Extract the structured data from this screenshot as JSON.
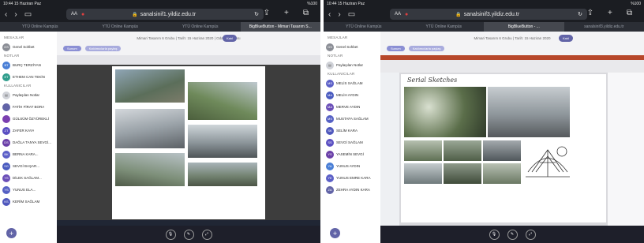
{
  "screens": [
    {
      "status": {
        "time": "10:44  15 Haziran Paz",
        "battery": "%100"
      },
      "url": "sanalsinif1.yildiz.edu.tr",
      "url_aa": "AA",
      "tabs": [
        {
          "label": "YTÜ Online Kampüs",
          "active": false
        },
        {
          "label": "YTÜ Online Kampüs",
          "active": false
        },
        {
          "label": "YTÜ Online Kampüs",
          "active": false
        },
        {
          "label": "BigBlueButton - Mimari Tasarım S...",
          "active": true
        }
      ],
      "sidebar": {
        "sections": [
          {
            "title": "MESAJLAR",
            "items": [
              {
                "initials": "GS",
                "label": "Genel Sohbet"
              }
            ]
          },
          {
            "title": "NOTLAR",
            "items": [
              {
                "initials": "BT",
                "label": "BURÇ TERZİYAN"
              },
              {
                "initials": "ET",
                "label": "ETHEM CAN TEKİN"
              }
            ]
          },
          {
            "title": "KULLANICILAR",
            "items": [
              {
                "initials": "",
                "label": "Paylaşılan Notlar"
              },
              {
                "initials": "",
                "label": "FATİH FİRAT BORA"
              },
              {
                "initials": "",
                "label": "GÜLSÜM ÖZYÜREKLİ"
              },
              {
                "initials": "ZT",
                "label": "ZAFER KAYA"
              },
              {
                "initials": "DS",
                "label": "DAĞLA TANYA SEVGİ..."
              },
              {
                "initials": "BK",
                "label": "BERNA KARA..."
              },
              {
                "initials": "SG",
                "label": "SEVGİ BAŞAR..."
              },
              {
                "initials": "YS",
                "label": "DİLEK SAĞLAM..."
              },
              {
                "initials": "YS",
                "label": "YUNUS ELA..."
              },
              {
                "initials": "KS",
                "label": "KERİM SAĞLAM"
              }
            ]
          }
        ]
      },
      "meeting": {
        "title": "Mimari Tasarım 6 Grubu | Tarih: 15 Haziran 2020 | Oda Kullanıcısı",
        "chip_primary": "Sunum",
        "chip_secondary": "Katılımcılarla paylaş",
        "join_label": "Katıl"
      },
      "callbar_icons": [
        "mic-icon",
        "video-icon",
        "share-icon"
      ]
    },
    {
      "status": {
        "time": "10:44  15 Haziran Paz",
        "battery": "%100"
      },
      "url": "sanalsinif3.yildiz.edu.tr",
      "url_aa": "AA",
      "tabs": [
        {
          "label": "YTÜ Online Kampüs",
          "active": false
        },
        {
          "label": "YTÜ Online Kampüs",
          "active": false
        },
        {
          "label": "BigBlueButton - ...",
          "active": true
        },
        {
          "label": "sanalsinif3.yildiz.edu.tr",
          "active": false
        }
      ],
      "sidebar": {
        "sections": [
          {
            "title": "MESAJLAR",
            "items": [
              {
                "initials": "GS",
                "label": "Genel Sohbet"
              }
            ]
          },
          {
            "title": "NOTLAR",
            "items": [
              {
                "initials": "",
                "label": "Paylaşılan Notlar"
              }
            ]
          },
          {
            "title": "KULLANICILAR",
            "items": [
              {
                "initials": "MS",
                "label": "MELİS SAĞLAM"
              },
              {
                "initials": "MA",
                "label": "MELİH AYDIN"
              },
              {
                "initials": "MA",
                "label": "MERVE AYDIN"
              },
              {
                "initials": "MS",
                "label": "MUSTAFA SAĞLAM"
              },
              {
                "initials": "SK",
                "label": "SELİM KARA"
              },
              {
                "initials": "SS",
                "label": "SEVGİ SAĞLAM"
              },
              {
                "initials": "YS",
                "label": "YASEMİN SEVGİ"
              },
              {
                "initials": "YA",
                "label": "YUNUS AYDIN"
              },
              {
                "initials": "YE",
                "label": "YUNUS EMRE KARA"
              },
              {
                "initials": "ZA",
                "label": "ZEHRA AYDIN KARA"
              }
            ]
          }
        ]
      },
      "meeting": {
        "title": "Mimari Tasarım 6 Grubu | Tarih: 15 Haziran 2020",
        "chip_primary": "Sunum",
        "chip_secondary": "Katılımcılarla paylaş",
        "join_label": "Katıl",
        "slide_title": "Serial Sketches"
      },
      "callbar_icons": [
        "mic-icon",
        "video-icon",
        "share-icon"
      ]
    }
  ],
  "colors": {
    "accent": "#6264a7",
    "mic": "#e04040",
    "chrome": "#1b1d22"
  }
}
